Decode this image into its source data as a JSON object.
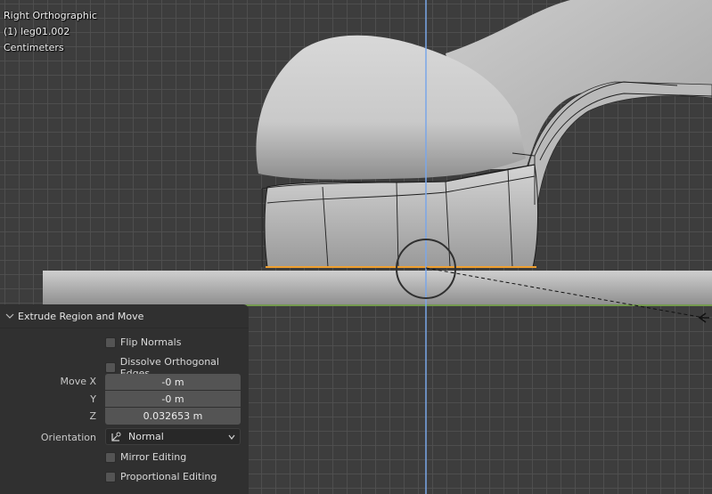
{
  "viewport": {
    "view_name": "Right Orthographic",
    "object_name": "(1) leg01.002",
    "units": "Centimeters"
  },
  "operator_panel": {
    "title": "Extrude Region and Move",
    "flip_normals": {
      "label": "Flip Normals",
      "checked": false
    },
    "dissolve_orthogonal_edges": {
      "label": "Dissolve Orthogonal Edges",
      "checked": false
    },
    "move": {
      "x": {
        "label": "Move X",
        "value": "-0 m"
      },
      "y": {
        "label": "Y",
        "value": "-0 m"
      },
      "z": {
        "label": "Z",
        "value": "0.032653 m"
      }
    },
    "orientation": {
      "label": "Orientation",
      "value": "Normal",
      "icon": "transform-orientation-icon"
    },
    "mirror_editing": {
      "label": "Mirror Editing",
      "checked": false
    },
    "proportional_editing": {
      "label": "Proportional Editing",
      "checked": false
    }
  },
  "colors": {
    "background": "#3d3d3d",
    "grid": "#505050",
    "axis_blue": "#7aa6e8",
    "axis_green": "#6b9e3a",
    "selection_orange": "#f0a030",
    "panel": "#303030",
    "field": "#545454"
  }
}
